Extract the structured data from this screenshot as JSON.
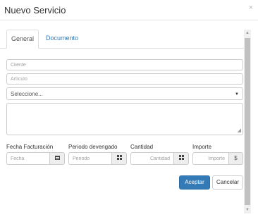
{
  "modal": {
    "title": "Nuevo Servicio",
    "close_symbol": "×"
  },
  "tabs": [
    {
      "label": "General",
      "active": true
    },
    {
      "label": "Documento",
      "active": false
    }
  ],
  "form": {
    "cliente_placeholder": "Cliente",
    "articulo_placeholder": "Artículo",
    "select_value": "Seleccione...",
    "fecha_label": "Fecha Facturación",
    "fecha_placeholder": "Fecha",
    "periodo_label": "Periodo devengado",
    "periodo_placeholder": "Periodo",
    "cantidad_label": "Cantidad",
    "cantidad_placeholder": "Cantidad",
    "importe_label": "Importe",
    "importe_placeholder": "Importe",
    "importe_addon": "$"
  },
  "actions": {
    "accept_label": "Aceptar",
    "cancel_label": "Cancelar"
  },
  "colors": {
    "primary": "#337ab7",
    "tab_link": "#337ab7"
  },
  "icons": {
    "close": "close-icon",
    "select_caret": "caret-down-icon",
    "calendar": "calendar-icon",
    "grid": "grid-icon"
  }
}
